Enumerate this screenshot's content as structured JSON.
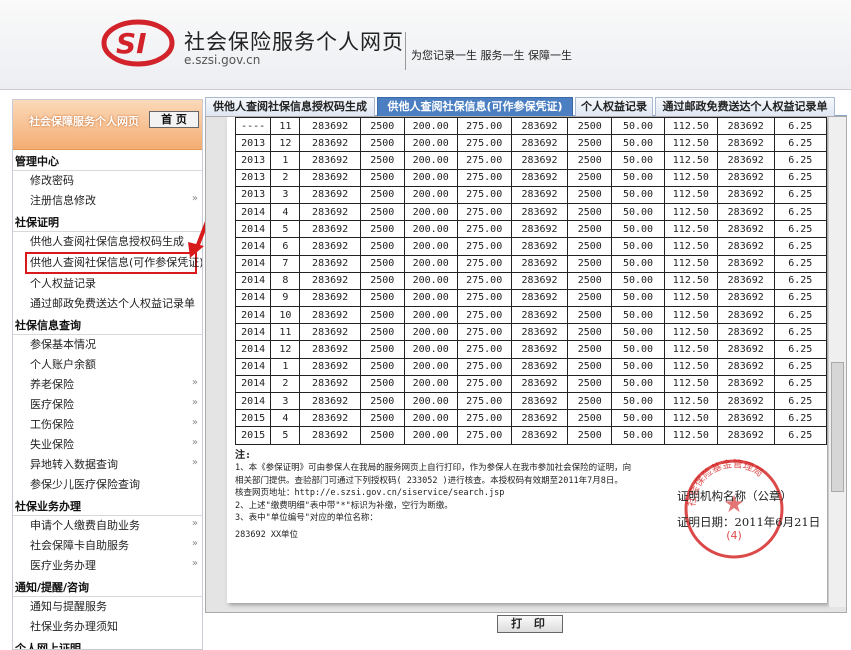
{
  "header": {
    "title": "社会保险服务个人网页",
    "domain": "e.szsi.gov.cn",
    "slogan": "为您记录一生  服务一生  保障一生"
  },
  "sidebar": {
    "title": "社会保障服务个人网页",
    "home_label": "首 页",
    "groups": [
      {
        "title": "管理中心",
        "items": [
          {
            "label": "修改密码",
            "arrow": false
          },
          {
            "label": "注册信息修改",
            "arrow": true
          }
        ]
      },
      {
        "title": "社保证明",
        "items": [
          {
            "label": "供他人查阅社保信息授权码生成",
            "arrow": false
          },
          {
            "label": "供他人查阅社保信息(可作参保凭证)",
            "arrow": false,
            "highlight": true
          },
          {
            "label": "个人权益记录",
            "arrow": false
          },
          {
            "label": "通过邮政免费送达个人权益记录单",
            "arrow": false
          }
        ]
      },
      {
        "title": "社保信息查询",
        "items": [
          {
            "label": "参保基本情况",
            "arrow": false
          },
          {
            "label": "个人账户余额",
            "arrow": false
          },
          {
            "label": "养老保险",
            "arrow": true
          },
          {
            "label": "医疗保险",
            "arrow": true
          },
          {
            "label": "工伤保险",
            "arrow": true
          },
          {
            "label": "失业保险",
            "arrow": true
          },
          {
            "label": "异地转入数据查询",
            "arrow": true
          },
          {
            "label": "参保少儿医疗保险查询",
            "arrow": false
          }
        ]
      },
      {
        "title": "社保业务办理",
        "items": [
          {
            "label": "申请个人缴费自助业务",
            "arrow": true
          },
          {
            "label": "社会保障卡自助服务",
            "arrow": true
          },
          {
            "label": "医疗业务办理",
            "arrow": true
          }
        ]
      },
      {
        "title": "通知/提醒/咨询",
        "items": [
          {
            "label": "通知与提醒服务",
            "arrow": false
          },
          {
            "label": "社保业务办理须知",
            "arrow": false
          }
        ]
      },
      {
        "title": "个人网上证明",
        "items": []
      }
    ]
  },
  "tabs": [
    {
      "label": "供他人查阅社保信息授权码生成",
      "active": false
    },
    {
      "label": "供他人查阅社保信息(可作参保凭证)",
      "active": true
    },
    {
      "label": "个人权益记录",
      "active": false
    },
    {
      "label": "通过邮政免费送达个人权益记录单",
      "active": false
    }
  ],
  "table_rows": [
    [
      "----",
      "11",
      "283692",
      "2500",
      "200.00",
      "275.00",
      "283692",
      "2500",
      "50.00",
      "112.50",
      "283692",
      "6.25"
    ],
    [
      "2013",
      "12",
      "283692",
      "2500",
      "200.00",
      "275.00",
      "283692",
      "2500",
      "50.00",
      "112.50",
      "283692",
      "6.25"
    ],
    [
      "2013",
      "1",
      "283692",
      "2500",
      "200.00",
      "275.00",
      "283692",
      "2500",
      "50.00",
      "112.50",
      "283692",
      "6.25"
    ],
    [
      "2013",
      "2",
      "283692",
      "2500",
      "200.00",
      "275.00",
      "283692",
      "2500",
      "50.00",
      "112.50",
      "283692",
      "6.25"
    ],
    [
      "2013",
      "3",
      "283692",
      "2500",
      "200.00",
      "275.00",
      "283692",
      "2500",
      "50.00",
      "112.50",
      "283692",
      "6.25"
    ],
    [
      "2014",
      "4",
      "283692",
      "2500",
      "200.00",
      "275.00",
      "283692",
      "2500",
      "50.00",
      "112.50",
      "283692",
      "6.25"
    ],
    [
      "2014",
      "5",
      "283692",
      "2500",
      "200.00",
      "275.00",
      "283692",
      "2500",
      "50.00",
      "112.50",
      "283692",
      "6.25"
    ],
    [
      "2014",
      "6",
      "283692",
      "2500",
      "200.00",
      "275.00",
      "283692",
      "2500",
      "50.00",
      "112.50",
      "283692",
      "6.25"
    ],
    [
      "2014",
      "7",
      "283692",
      "2500",
      "200.00",
      "275.00",
      "283692",
      "2500",
      "50.00",
      "112.50",
      "283692",
      "6.25"
    ],
    [
      "2014",
      "8",
      "283692",
      "2500",
      "200.00",
      "275.00",
      "283692",
      "2500",
      "50.00",
      "112.50",
      "283692",
      "6.25"
    ],
    [
      "2014",
      "9",
      "283692",
      "2500",
      "200.00",
      "275.00",
      "283692",
      "2500",
      "50.00",
      "112.50",
      "283692",
      "6.25"
    ],
    [
      "2014",
      "10",
      "283692",
      "2500",
      "200.00",
      "275.00",
      "283692",
      "2500",
      "50.00",
      "112.50",
      "283692",
      "6.25"
    ],
    [
      "2014",
      "11",
      "283692",
      "2500",
      "200.00",
      "275.00",
      "283692",
      "2500",
      "50.00",
      "112.50",
      "283692",
      "6.25"
    ],
    [
      "2014",
      "12",
      "283692",
      "2500",
      "200.00",
      "275.00",
      "283692",
      "2500",
      "50.00",
      "112.50",
      "283692",
      "6.25"
    ],
    [
      "2014",
      "1",
      "283692",
      "2500",
      "200.00",
      "275.00",
      "283692",
      "2500",
      "50.00",
      "112.50",
      "283692",
      "6.25"
    ],
    [
      "2014",
      "2",
      "283692",
      "2500",
      "200.00",
      "275.00",
      "283692",
      "2500",
      "50.00",
      "112.50",
      "283692",
      "6.25"
    ],
    [
      "2014",
      "3",
      "283692",
      "2500",
      "200.00",
      "275.00",
      "283692",
      "2500",
      "50.00",
      "112.50",
      "283692",
      "6.25"
    ],
    [
      "2015",
      "4",
      "283692",
      "2500",
      "200.00",
      "275.00",
      "283692",
      "2500",
      "50.00",
      "112.50",
      "283692",
      "6.25"
    ],
    [
      "2015",
      "5",
      "283692",
      "2500",
      "200.00",
      "275.00",
      "283692",
      "2500",
      "50.00",
      "112.50",
      "283692",
      "6.25"
    ]
  ],
  "notes": {
    "title": "注:",
    "lines": [
      "1、本《参保证明》可由参保人在我局的服务网页上自行打印，作为参保人在我市参加社会保险的证明，向",
      "相关部门提供。查验部门可通过下列授权码( 233052 )进行核查。本授权码有效期至2011年7月8日。",
      "核查网页地址：http://e.szsi.gov.cn/siservice/search.jsp",
      "2、上述\"缴费明细\"表中带\"*\"标识为补缴，空行为断缴。",
      "3、表中\"单位编号\"对应的单位名称："
    ],
    "unit_line": "283692    XX单位"
  },
  "certificate": {
    "org_label": "证明机构名称（公章）",
    "date_label": "证明日期：2011年6月21日",
    "seal_number": "(4)",
    "seal_text": "社会保险基金管理局"
  },
  "print_label": "打 印",
  "colors": {
    "active_tab": "#4c7fc1",
    "sidebar_head": "#f4ad73",
    "highlight": "#d91a1a",
    "seal": "#d21b1b"
  }
}
